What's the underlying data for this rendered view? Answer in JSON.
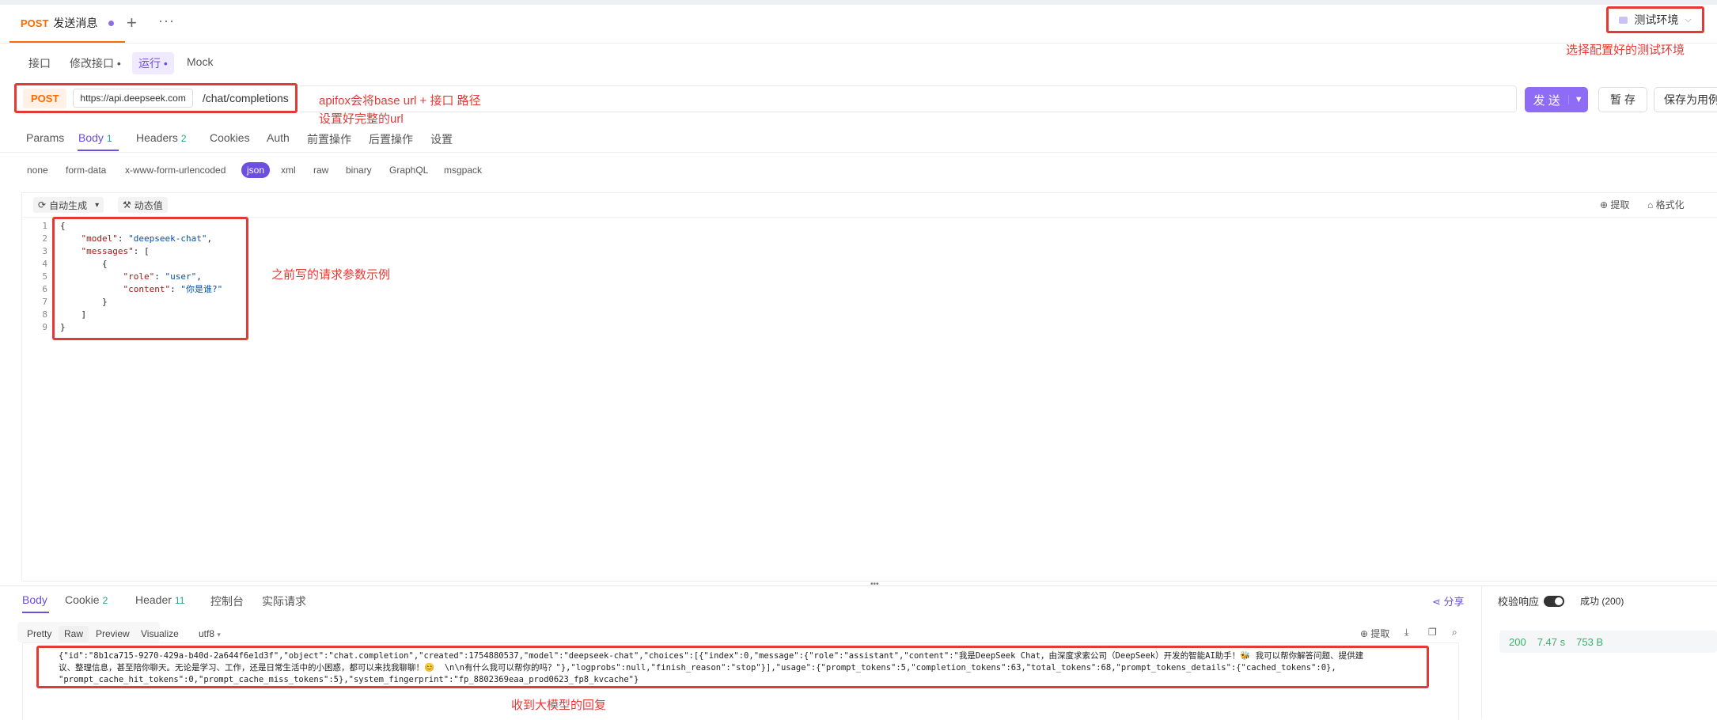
{
  "tab": {
    "method": "POST",
    "title": "发送消息",
    "plus": "+",
    "more": "···"
  },
  "env": {
    "label": "测试环境",
    "note": "选择配置好的测试环境"
  },
  "subtabs": [
    "接口",
    "修改接口 •",
    "运行 •",
    "Mock"
  ],
  "url": {
    "method": "POST",
    "base": "https://api.deepseek.com",
    "path": "/chat/completions",
    "note_line1": "apifox会将base url + 接口 路径",
    "note_line2": "设置好完整的url"
  },
  "buttons": {
    "send": "发 送",
    "save": "暂 存",
    "save_case": "保存为用例"
  },
  "request_tabs": {
    "params": "Params",
    "body": "Body",
    "body_count": "1",
    "headers": "Headers",
    "headers_count": "2",
    "cookies": "Cookies",
    "auth": "Auth",
    "pre": "前置操作",
    "post": "后置操作",
    "settings": "设置"
  },
  "body_types": [
    "none",
    "form-data",
    "x-www-form-urlencoded",
    "json",
    "xml",
    "raw",
    "binary",
    "GraphQL",
    "msgpack"
  ],
  "editor": {
    "auto_gen": "自动生成",
    "dynamic": "动态值",
    "extract": "提取",
    "format": "格式化",
    "note": "之前写的请求参数示例",
    "lines": [
      "1",
      "2",
      "3",
      "4",
      "5",
      "6",
      "7",
      "8",
      "9"
    ]
  },
  "request_body": {
    "model_key": "\"model\"",
    "model_val": "\"deepseek-chat\"",
    "messages_key": "\"messages\"",
    "role_key": "\"role\"",
    "role_val": "\"user\"",
    "content_key": "\"content\"",
    "content_val": "\"你是谁?\""
  },
  "response": {
    "tabs": {
      "body": "Body",
      "cookie": "Cookie",
      "cookie_count": "2",
      "header": "Header",
      "header_count": "11",
      "console": "控制台",
      "actual": "实际请求"
    },
    "share": "分享",
    "formats": [
      "Pretty",
      "Raw",
      "Preview",
      "Visualize"
    ],
    "encoding": "utf8",
    "extract": "提取",
    "line1": "{\"id\":\"8b1ca715-9270-429a-b40d-2a644f6e1d3f\",\"object\":\"chat.completion\",\"created\":1754880537,\"model\":\"deepseek-chat\",\"choices\":[{\"index\":0,\"message\":{\"role\":\"assistant\",\"content\":\"我是DeepSeek Chat，由深度求索公司（DeepSeek）开发的智能AI助手！🐝 我可以帮你解答问题、提供建",
    "line2": "议、整理信息，甚至陪你聊天。无论是学习、工作，还是日常生活中的小困惑，都可以来找我聊聊！😊  \\n\\n有什么我可以帮你的吗？\"},\"logprobs\":null,\"finish_reason\":\"stop\"}],\"usage\":{\"prompt_tokens\":5,\"completion_tokens\":63,\"total_tokens\":68,\"prompt_tokens_details\":{\"cached_tokens\":0},",
    "line3": "\"prompt_cache_hit_tokens\":0,\"prompt_cache_miss_tokens\":5},\"system_fingerprint\":\"fp_8802369eaa_prod0623_fp8_kvcache\"}",
    "note": "收到大模型的回复",
    "verify": "校验响应",
    "success": "成功 (200)",
    "status": "200",
    "time": "7.47 s",
    "size": "753 B"
  }
}
